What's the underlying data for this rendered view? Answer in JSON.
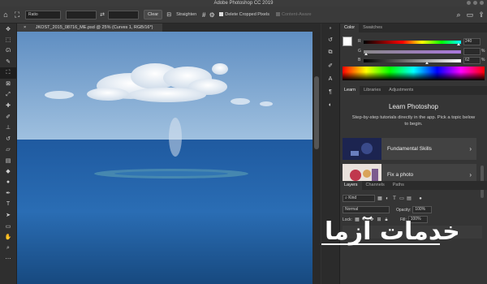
{
  "window": {
    "title": "Adobe Photoshop CC 2019"
  },
  "options_bar": {
    "ratio_label": "Ratio",
    "clear_label": "Clear",
    "straighten_label": "Straighten",
    "delete_cropped_label": "Delete Cropped Pixels",
    "content_aware_label": "Content-Aware"
  },
  "document": {
    "tab_title": "JKOST_2015_08716_ME.psd @ 25% (Curves 1, RGB/16*)",
    "close_glyph": "×"
  },
  "tools": [
    "move-icon",
    "marquee-icon",
    "lasso-icon",
    "quick-select-icon",
    "crop-icon",
    "frame-icon",
    "eyedropper-icon",
    "healing-icon",
    "brush-icon",
    "clone-stamp-icon",
    "history-brush-icon",
    "eraser-icon",
    "gradient-icon",
    "blur-icon",
    "dodge-icon",
    "pen-icon",
    "type-icon",
    "path-select-icon",
    "rectangle-icon",
    "hand-icon",
    "zoom-icon",
    "more-icon"
  ],
  "color_panel": {
    "tabs": [
      "Color",
      "Swatches"
    ],
    "active_tab": "Color",
    "r_label": "R",
    "g_label": "G",
    "b_label": "B",
    "r_value": "240",
    "g_value": "",
    "b_value": "62",
    "r_unit": "",
    "g_unit": "%",
    "b_unit": "%"
  },
  "learn_panel": {
    "tabs": [
      "Learn",
      "Libraries",
      "Adjustments"
    ],
    "active_tab": "Learn",
    "title": "Learn Photoshop",
    "description": "Step-by-step tutorials directly in the app. Pick a topic below to begin.",
    "cards": [
      {
        "label": "Fundamental Skills",
        "chevron": "›"
      },
      {
        "label": "Fix a photo",
        "chevron": "›"
      }
    ]
  },
  "layers_panel": {
    "tabs": [
      "Layers",
      "Channels",
      "Paths"
    ],
    "active_tab": "Layers",
    "kind_label": "Kind",
    "blend_mode": "Normal",
    "opacity_label": "Opacity:",
    "opacity_value": "100%",
    "lock_label": "Lock:",
    "fill_label": "Fill:",
    "fill_value": "100%"
  },
  "watermark": {
    "text": "خدمات آزما"
  },
  "colors": {
    "accent": "#2d7ad6",
    "panel_bg": "#353535",
    "chrome_bg": "#3a3a3a"
  }
}
